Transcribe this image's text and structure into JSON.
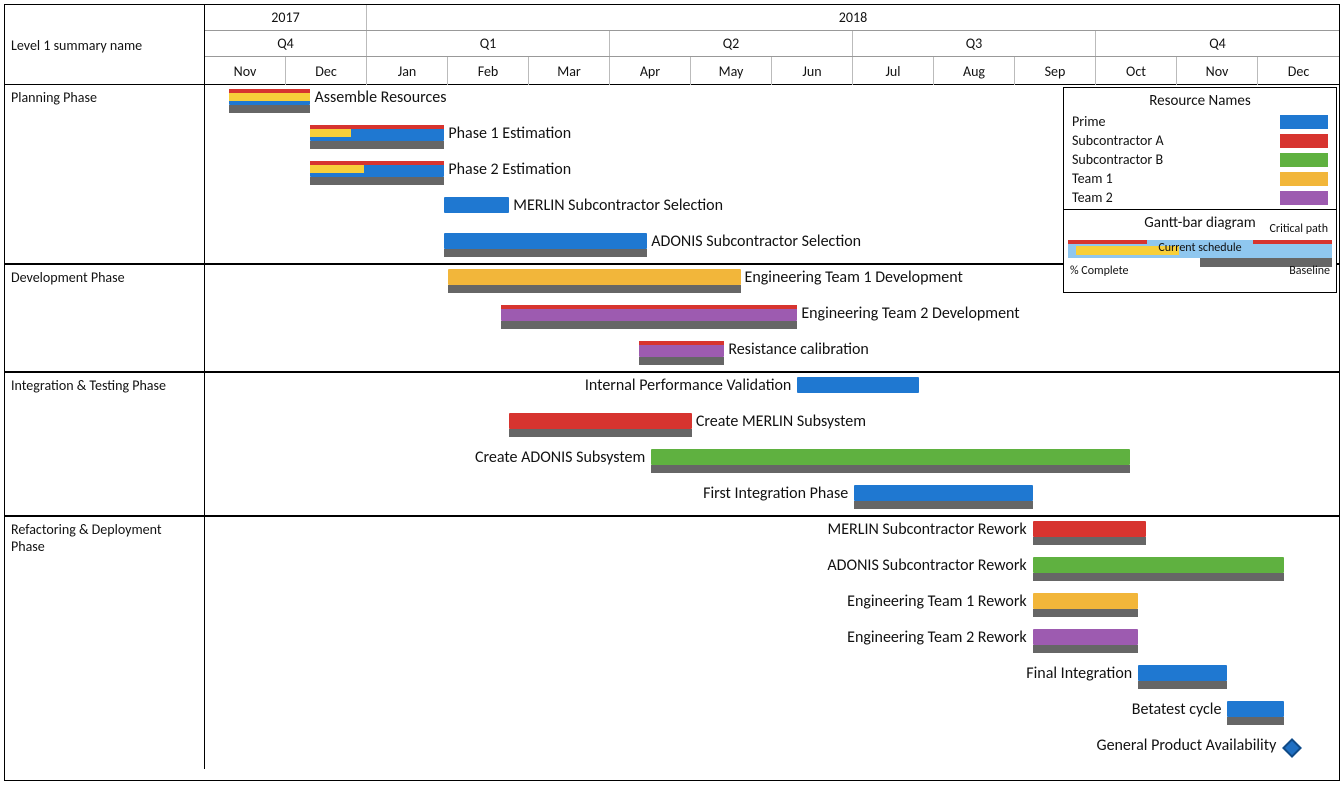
{
  "chart_data": {
    "type": "gantt",
    "title": "Level 1 summary name",
    "timeline": {
      "start": "2017-11",
      "end": "2018-12",
      "months": [
        "Nov",
        "Dec",
        "Jan",
        "Feb",
        "Mar",
        "Apr",
        "May",
        "Jun",
        "Jul",
        "Aug",
        "Sep",
        "Oct",
        "Nov",
        "Dec"
      ],
      "quarters": [
        {
          "label": "Q4",
          "span": 2
        },
        {
          "label": "Q1",
          "span": 3
        },
        {
          "label": "Q2",
          "span": 3
        },
        {
          "label": "Q3",
          "span": 3
        },
        {
          "label": "Q4",
          "span": 3
        }
      ],
      "years": [
        {
          "label": "2017",
          "span": 2
        },
        {
          "label": "2018",
          "span": 12
        }
      ]
    },
    "resource_colors": {
      "Prime": "#1f78d1",
      "Subcontractor A": "#d7342f",
      "Subcontractor B": "#5fb140",
      "Team 1": "#f2b63a",
      "Team 2": "#9d5bb0"
    },
    "phases": [
      {
        "name": "Planning Phase",
        "tasks": [
          {
            "label": "Assemble Resources",
            "start": 0.3,
            "end": 1.3,
            "resource": "Prime",
            "critical": true,
            "complete": 1.0,
            "baseline": true,
            "label_side": "right"
          },
          {
            "label": "Phase 1 Estimation",
            "start": 1.3,
            "end": 2.95,
            "resource": "Prime",
            "critical": true,
            "complete": 0.3,
            "baseline": true,
            "label_side": "right"
          },
          {
            "label": "Phase 2 Estimation",
            "start": 1.3,
            "end": 2.95,
            "resource": "Prime",
            "critical": true,
            "complete": 0.4,
            "baseline": true,
            "label_side": "right"
          },
          {
            "label": "MERLIN Subcontractor Selection",
            "start": 2.95,
            "end": 3.75,
            "resource": "Prime",
            "critical": false,
            "complete": 0.0,
            "baseline": false,
            "label_side": "right"
          },
          {
            "label": "ADONIS Subcontractor Selection",
            "start": 2.95,
            "end": 5.45,
            "resource": "Prime",
            "critical": false,
            "complete": 0.0,
            "baseline": true,
            "label_side": "right"
          }
        ]
      },
      {
        "name": "Development Phase",
        "tasks": [
          {
            "label": "Engineering Team 1 Development",
            "start": 3.0,
            "end": 6.6,
            "resource": "Team 1",
            "critical": false,
            "complete": 0.0,
            "baseline": true,
            "label_side": "right"
          },
          {
            "label": "Engineering Team 2 Development",
            "start": 3.65,
            "end": 7.3,
            "resource": "Team 2",
            "critical": true,
            "complete": 0.0,
            "baseline": true,
            "label_side": "right"
          },
          {
            "label": "Resistance calibration",
            "start": 5.35,
            "end": 6.4,
            "resource": "Team 2",
            "critical": true,
            "complete": 0.0,
            "baseline": true,
            "label_side": "right"
          }
        ]
      },
      {
        "name": "Integration & Testing Phase",
        "tasks": [
          {
            "label": "Internal Performance Validation",
            "start": 7.3,
            "end": 8.8,
            "resource": "Prime",
            "critical": false,
            "complete": 0.0,
            "baseline": false,
            "label_side": "left"
          },
          {
            "label": "Create MERLIN Subsystem",
            "start": 3.75,
            "end": 6.0,
            "resource": "Subcontractor A",
            "critical": false,
            "complete": 0.0,
            "baseline": true,
            "label_side": "right"
          },
          {
            "label": "Create ADONIS Subsystem",
            "start": 5.5,
            "end": 11.4,
            "resource": "Subcontractor B",
            "critical": false,
            "complete": 0.0,
            "baseline": true,
            "label_side": "left"
          },
          {
            "label": "First Integration Phase",
            "start": 8.0,
            "end": 10.2,
            "resource": "Prime",
            "critical": false,
            "complete": 0.0,
            "baseline": true,
            "label_side": "left"
          }
        ]
      },
      {
        "name": "Refactoring & Deployment Phase",
        "tasks": [
          {
            "label": "MERLIN Subcontractor Rework",
            "start": 10.2,
            "end": 11.6,
            "resource": "Subcontractor A",
            "critical": false,
            "complete": 0.0,
            "baseline": true,
            "label_side": "left"
          },
          {
            "label": "ADONIS Subcontractor Rework",
            "start": 10.2,
            "end": 13.3,
            "resource": "Subcontractor B",
            "critical": false,
            "complete": 0.0,
            "baseline": true,
            "label_side": "left"
          },
          {
            "label": "Engineering Team 1 Rework",
            "start": 10.2,
            "end": 11.5,
            "resource": "Team 1",
            "critical": false,
            "complete": 0.0,
            "baseline": true,
            "label_side": "left"
          },
          {
            "label": "Engineering Team 2 Rework",
            "start": 10.2,
            "end": 11.5,
            "resource": "Team 2",
            "critical": false,
            "complete": 0.0,
            "baseline": true,
            "label_side": "left"
          },
          {
            "label": "Final Integration",
            "start": 11.5,
            "end": 12.6,
            "resource": "Prime",
            "critical": false,
            "complete": 0.0,
            "baseline": true,
            "label_side": "left"
          },
          {
            "label": "Betatest cycle",
            "start": 12.6,
            "end": 13.3,
            "resource": "Prime",
            "critical": false,
            "complete": 0.0,
            "baseline": true,
            "label_side": "left"
          },
          {
            "label": "General Product Availability",
            "milestone": true,
            "at": 13.4,
            "label_side": "left"
          }
        ]
      }
    ],
    "legend_title": "Resource Names",
    "legend_items": [
      {
        "label": "Prime",
        "swatch": "#1f78d1"
      },
      {
        "label": "Subcontractor A",
        "swatch": "#d7342f"
      },
      {
        "label": "Subcontractor B",
        "swatch": "#5fb140"
      },
      {
        "label": "Team 1",
        "swatch": "#f2b63a"
      },
      {
        "label": "Team 2",
        "swatch": "#9d5bb0"
      }
    ],
    "legend_diagram": {
      "title": "Gantt-bar diagram",
      "labels": {
        "critical": "Critical path",
        "schedule": "Current schedule",
        "complete": "% Complete",
        "baseline": "Baseline"
      }
    }
  }
}
